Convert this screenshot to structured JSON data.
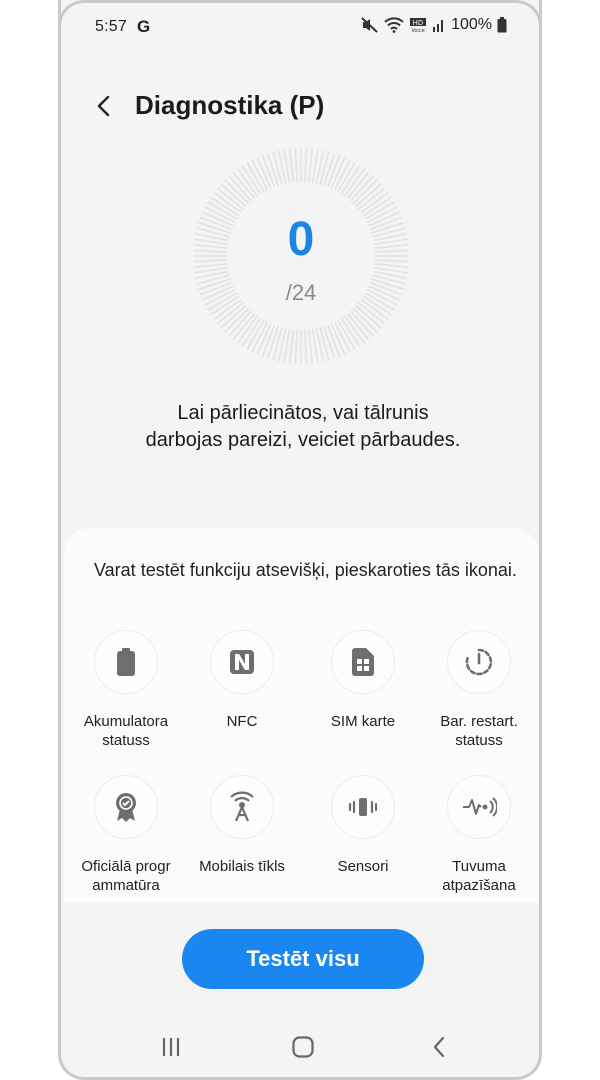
{
  "status_bar": {
    "time": "5:57",
    "google_badge": "G",
    "hd_voice": "HD Voice",
    "battery_percent": "100%",
    "icons": [
      "mute-icon",
      "wifi-icon",
      "hd-voice-icon",
      "signal-icon",
      "battery-icon"
    ]
  },
  "header": {
    "title": "Diagnostika (P)",
    "back_icon": "back-arrow-icon"
  },
  "progress": {
    "completed": "0",
    "total": "/24"
  },
  "description": "Lai pārliecinātos, vai tālrunis darbojas pareizi, veiciet pārbaudes.",
  "tests": {
    "hint": "Varat testēt funkciju atsevišķi, pieskaroties tās ikonai.",
    "items": [
      {
        "label": "Akumulatora statuss",
        "icon": "battery-icon"
      },
      {
        "label": "NFC",
        "icon": "nfc-icon"
      },
      {
        "label": "SIM karte",
        "icon": "sim-card-icon"
      },
      {
        "label": "Bar. restart. statuss",
        "icon": "power-restart-icon"
      },
      {
        "label": "Oficiālā progr ammatūra",
        "icon": "certified-badge-icon"
      },
      {
        "label": "Mobilais tīkls",
        "icon": "cell-tower-icon"
      },
      {
        "label": "Sensori",
        "icon": "vibration-sensor-icon"
      },
      {
        "label": "Tuvuma atpazīšana",
        "icon": "proximity-wave-icon"
      }
    ]
  },
  "cta": {
    "label": "Testēt visu"
  },
  "nav": {
    "recents_icon": "recents-icon",
    "home_icon": "home-icon",
    "back_icon": "nav-back-icon"
  },
  "colors": {
    "accent": "#1a87f0",
    "score": "#1a87e6"
  }
}
